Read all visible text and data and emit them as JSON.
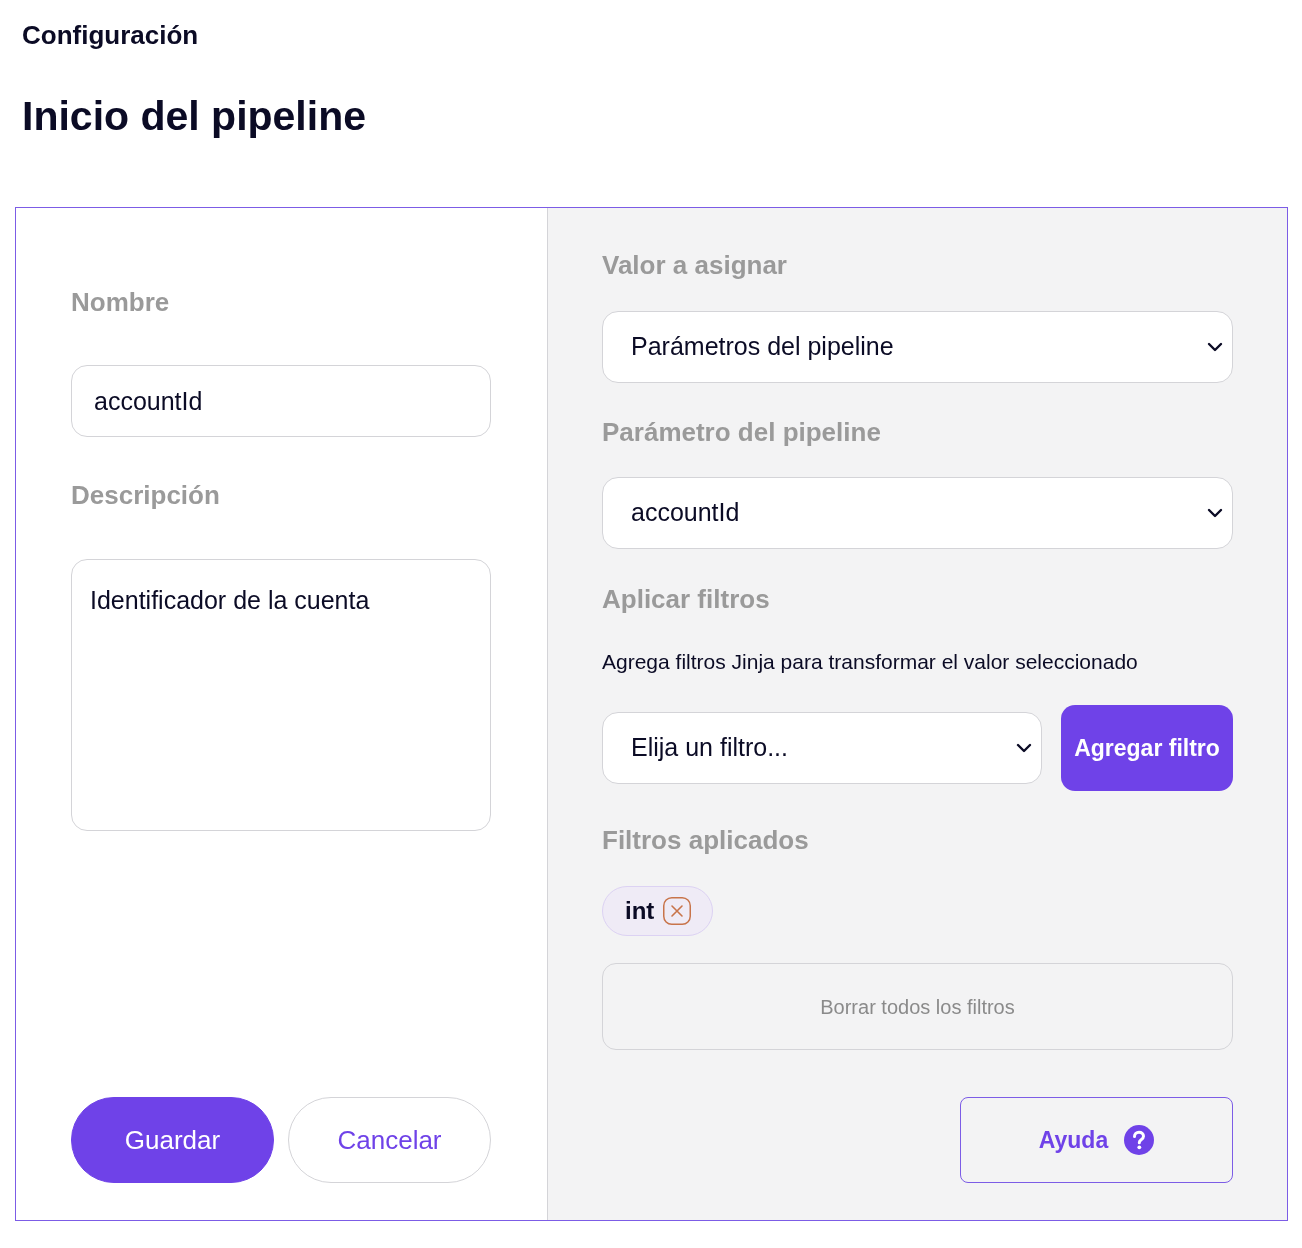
{
  "header": {
    "breadcrumb": "Configuración",
    "title": "Inicio del pipeline"
  },
  "left": {
    "name_field": {
      "label": "Nombre",
      "value": "accountId"
    },
    "description_field": {
      "label": "Descripción",
      "value": "Identificador de la cuenta"
    },
    "buttons": [
      {
        "kind": "primary",
        "label": "Guardar"
      },
      {
        "kind": "secondary",
        "label": "Cancelar"
      }
    ]
  },
  "right": {
    "value_source": {
      "label": "Valor a asignar",
      "value": "Parámetros del pipeline"
    },
    "pipeline_parameter": {
      "label": "Parámetro del pipeline",
      "value": "accountId"
    },
    "filters": {
      "label": "Aplicar filtros",
      "hint": "Agrega filtros Jinja para transformar el valor seleccionado",
      "select": {
        "value": "Elija un filtro..."
      },
      "add_button": "Agregar filtro"
    },
    "applied": {
      "label": "Filtros aplicados",
      "chips": [
        {
          "label": "int"
        }
      ],
      "clear_button": "Borrar todos los filtros"
    },
    "help_button": "Ayuda"
  }
}
